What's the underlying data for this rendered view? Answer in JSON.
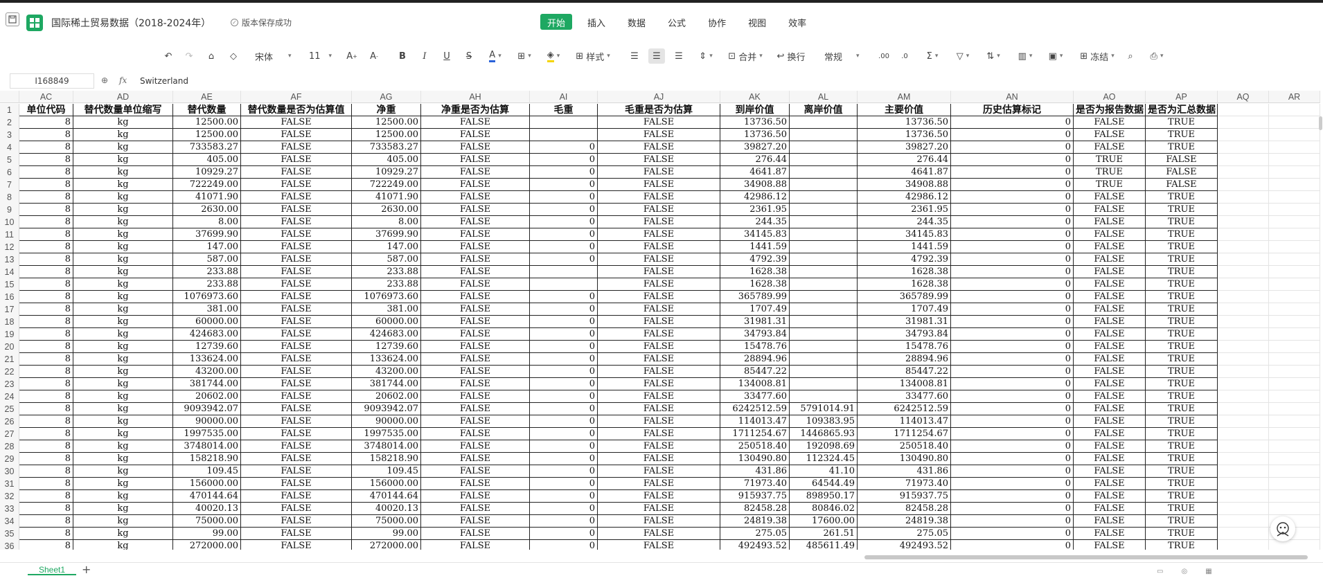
{
  "app": {
    "title": "国际稀土贸易数据（2018-2024年）",
    "save_status": "版本保存成功",
    "menu": [
      "开始",
      "插入",
      "数据",
      "公式",
      "协作",
      "视图",
      "效率"
    ],
    "active_menu": "开始"
  },
  "toolbar": {
    "font_name": "宋体",
    "font_size": "11",
    "style_label": "样式",
    "merge_label": "合并",
    "wrap_label": "换行",
    "number_format": "常规",
    "freeze_label": "冻结"
  },
  "formula_bar": {
    "cell_ref": "I168849",
    "fx": "fx",
    "value": "Switzerland"
  },
  "columns": [
    "AC",
    "AD",
    "AE",
    "AF",
    "AG",
    "AH",
    "AI",
    "AJ",
    "AK",
    "AL",
    "AM",
    "AN",
    "AO",
    "AP",
    "AQ",
    "AR"
  ],
  "header_row": [
    "单位代码",
    "替代数量单位缩写",
    "替代数量",
    "替代数量是否为估算值",
    "净重",
    "净重是否为估算",
    "毛重",
    "毛重是否为估算",
    "到岸价值",
    "离岸价值",
    "主要价值",
    "历史估算标记",
    "是否为报告数据",
    "是否为汇总数据"
  ],
  "rows": [
    [
      "8",
      "kg",
      "12500.00",
      "FALSE",
      "12500.00",
      "FALSE",
      "",
      "FALSE",
      "13736.50",
      "",
      "13736.50",
      "0",
      "FALSE",
      "TRUE"
    ],
    [
      "8",
      "kg",
      "12500.00",
      "FALSE",
      "12500.00",
      "FALSE",
      "",
      "FALSE",
      "13736.50",
      "",
      "13736.50",
      "0",
      "FALSE",
      "TRUE"
    ],
    [
      "8",
      "kg",
      "733583.27",
      "FALSE",
      "733583.27",
      "FALSE",
      "0",
      "FALSE",
      "39827.20",
      "",
      "39827.20",
      "0",
      "FALSE",
      "TRUE"
    ],
    [
      "8",
      "kg",
      "405.00",
      "FALSE",
      "405.00",
      "FALSE",
      "0",
      "FALSE",
      "276.44",
      "",
      "276.44",
      "0",
      "TRUE",
      "FALSE"
    ],
    [
      "8",
      "kg",
      "10929.27",
      "FALSE",
      "10929.27",
      "FALSE",
      "0",
      "FALSE",
      "4641.87",
      "",
      "4641.87",
      "0",
      "TRUE",
      "FALSE"
    ],
    [
      "8",
      "kg",
      "722249.00",
      "FALSE",
      "722249.00",
      "FALSE",
      "0",
      "FALSE",
      "34908.88",
      "",
      "34908.88",
      "0",
      "TRUE",
      "FALSE"
    ],
    [
      "8",
      "kg",
      "41071.90",
      "FALSE",
      "41071.90",
      "FALSE",
      "0",
      "FALSE",
      "42986.12",
      "",
      "42986.12",
      "0",
      "FALSE",
      "TRUE"
    ],
    [
      "8",
      "kg",
      "2630.00",
      "FALSE",
      "2630.00",
      "FALSE",
      "0",
      "FALSE",
      "2361.95",
      "",
      "2361.95",
      "0",
      "FALSE",
      "TRUE"
    ],
    [
      "8",
      "kg",
      "8.00",
      "FALSE",
      "8.00",
      "FALSE",
      "0",
      "FALSE",
      "244.35",
      "",
      "244.35",
      "0",
      "FALSE",
      "TRUE"
    ],
    [
      "8",
      "kg",
      "37699.90",
      "FALSE",
      "37699.90",
      "FALSE",
      "0",
      "FALSE",
      "34145.83",
      "",
      "34145.83",
      "0",
      "FALSE",
      "TRUE"
    ],
    [
      "8",
      "kg",
      "147.00",
      "FALSE",
      "147.00",
      "FALSE",
      "0",
      "FALSE",
      "1441.59",
      "",
      "1441.59",
      "0",
      "FALSE",
      "TRUE"
    ],
    [
      "8",
      "kg",
      "587.00",
      "FALSE",
      "587.00",
      "FALSE",
      "0",
      "FALSE",
      "4792.39",
      "",
      "4792.39",
      "0",
      "FALSE",
      "TRUE"
    ],
    [
      "8",
      "kg",
      "233.88",
      "FALSE",
      "233.88",
      "FALSE",
      "",
      "FALSE",
      "1628.38",
      "",
      "1628.38",
      "0",
      "FALSE",
      "TRUE"
    ],
    [
      "8",
      "kg",
      "233.88",
      "FALSE",
      "233.88",
      "FALSE",
      "",
      "FALSE",
      "1628.38",
      "",
      "1628.38",
      "0",
      "FALSE",
      "TRUE"
    ],
    [
      "8",
      "kg",
      "1076973.60",
      "FALSE",
      "1076973.60",
      "FALSE",
      "0",
      "FALSE",
      "365789.99",
      "",
      "365789.99",
      "0",
      "FALSE",
      "TRUE"
    ],
    [
      "8",
      "kg",
      "381.00",
      "FALSE",
      "381.00",
      "FALSE",
      "0",
      "FALSE",
      "1707.49",
      "",
      "1707.49",
      "0",
      "FALSE",
      "TRUE"
    ],
    [
      "8",
      "kg",
      "60000.00",
      "FALSE",
      "60000.00",
      "FALSE",
      "0",
      "FALSE",
      "31981.31",
      "",
      "31981.31",
      "0",
      "FALSE",
      "TRUE"
    ],
    [
      "8",
      "kg",
      "424683.00",
      "FALSE",
      "424683.00",
      "FALSE",
      "0",
      "FALSE",
      "34793.84",
      "",
      "34793.84",
      "0",
      "FALSE",
      "TRUE"
    ],
    [
      "8",
      "kg",
      "12739.60",
      "FALSE",
      "12739.60",
      "FALSE",
      "0",
      "FALSE",
      "15478.76",
      "",
      "15478.76",
      "0",
      "FALSE",
      "TRUE"
    ],
    [
      "8",
      "kg",
      "133624.00",
      "FALSE",
      "133624.00",
      "FALSE",
      "0",
      "FALSE",
      "28894.96",
      "",
      "28894.96",
      "0",
      "FALSE",
      "TRUE"
    ],
    [
      "8",
      "kg",
      "43200.00",
      "FALSE",
      "43200.00",
      "FALSE",
      "0",
      "FALSE",
      "85447.22",
      "",
      "85447.22",
      "0",
      "FALSE",
      "TRUE"
    ],
    [
      "8",
      "kg",
      "381744.00",
      "FALSE",
      "381744.00",
      "FALSE",
      "0",
      "FALSE",
      "134008.81",
      "",
      "134008.81",
      "0",
      "FALSE",
      "TRUE"
    ],
    [
      "8",
      "kg",
      "20602.00",
      "FALSE",
      "20602.00",
      "FALSE",
      "0",
      "FALSE",
      "33477.60",
      "",
      "33477.60",
      "0",
      "FALSE",
      "TRUE"
    ],
    [
      "8",
      "kg",
      "9093942.07",
      "FALSE",
      "9093942.07",
      "FALSE",
      "0",
      "FALSE",
      "6242512.59",
      "5791014.91",
      "6242512.59",
      "0",
      "FALSE",
      "TRUE"
    ],
    [
      "8",
      "kg",
      "90000.00",
      "FALSE",
      "90000.00",
      "FALSE",
      "0",
      "FALSE",
      "114013.47",
      "109383.95",
      "114013.47",
      "0",
      "FALSE",
      "TRUE"
    ],
    [
      "8",
      "kg",
      "1997535.00",
      "FALSE",
      "1997535.00",
      "FALSE",
      "0",
      "FALSE",
      "1711254.67",
      "1446865.93",
      "1711254.67",
      "0",
      "FALSE",
      "TRUE"
    ],
    [
      "8",
      "kg",
      "3748014.00",
      "FALSE",
      "3748014.00",
      "FALSE",
      "0",
      "FALSE",
      "250518.40",
      "192098.69",
      "250518.40",
      "0",
      "FALSE",
      "TRUE"
    ],
    [
      "8",
      "kg",
      "158218.90",
      "FALSE",
      "158218.90",
      "FALSE",
      "0",
      "FALSE",
      "130490.80",
      "112324.45",
      "130490.80",
      "0",
      "FALSE",
      "TRUE"
    ],
    [
      "8",
      "kg",
      "109.45",
      "FALSE",
      "109.45",
      "FALSE",
      "0",
      "FALSE",
      "431.86",
      "41.10",
      "431.86",
      "0",
      "FALSE",
      "TRUE"
    ],
    [
      "8",
      "kg",
      "156000.00",
      "FALSE",
      "156000.00",
      "FALSE",
      "0",
      "FALSE",
      "71973.40",
      "64544.49",
      "71973.40",
      "0",
      "FALSE",
      "TRUE"
    ],
    [
      "8",
      "kg",
      "470144.64",
      "FALSE",
      "470144.64",
      "FALSE",
      "0",
      "FALSE",
      "915937.75",
      "898950.17",
      "915937.75",
      "0",
      "FALSE",
      "TRUE"
    ],
    [
      "8",
      "kg",
      "40020.13",
      "FALSE",
      "40020.13",
      "FALSE",
      "0",
      "FALSE",
      "82458.28",
      "80846.02",
      "82458.28",
      "0",
      "FALSE",
      "TRUE"
    ],
    [
      "8",
      "kg",
      "75000.00",
      "FALSE",
      "75000.00",
      "FALSE",
      "0",
      "FALSE",
      "24819.38",
      "17600.00",
      "24819.38",
      "0",
      "FALSE",
      "TRUE"
    ],
    [
      "8",
      "kg",
      "99.00",
      "FALSE",
      "99.00",
      "FALSE",
      "0",
      "FALSE",
      "275.05",
      "261.51",
      "275.05",
      "0",
      "FALSE",
      "TRUE"
    ],
    [
      "8",
      "kg",
      "272000.00",
      "FALSE",
      "272000.00",
      "FALSE",
      "0",
      "FALSE",
      "492493.52",
      "485611.49",
      "492493.52",
      "0",
      "FALSE",
      "TRUE"
    ]
  ],
  "sheet_tabs": [
    "Sheet1"
  ],
  "colors": {
    "accent": "#1ea862"
  }
}
